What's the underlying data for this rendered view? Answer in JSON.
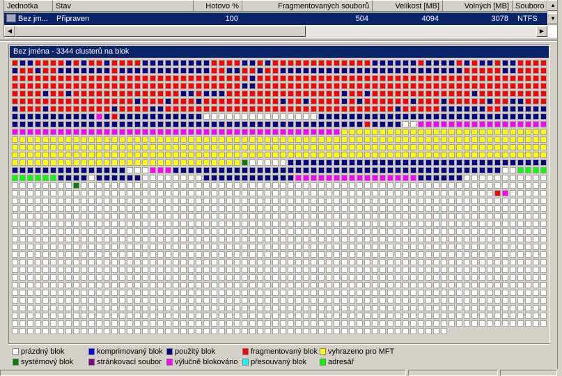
{
  "list": {
    "columns": [
      "Jednotka",
      "Stav",
      "Hotovo %",
      "Fragmentovaných souborů",
      "Velikost [MB]",
      "Volných [MB]",
      "Souboro"
    ],
    "rows": [
      {
        "drive": "Bez jm...",
        "status": "Připraven",
        "done": "100",
        "fragmented": "504",
        "size": "4094",
        "free": "3078",
        "fs": "NTFS"
      }
    ]
  },
  "map": {
    "title": "Bez jména - 3344 clusterů na blok",
    "columns": 70,
    "colors": {
      "W": "#ffffff",
      "B": "#000080",
      "R": "#ff0000",
      "M": "#ff00ff",
      "Y": "#ffff00",
      "G": "#008000",
      "L": "#00ff00",
      "C": "#0000ff",
      "P": "#800080",
      "T": "#00ffff"
    },
    "rows": [
      "R1 B2 R4 B1 R1 B1 R2 B1 R4 B9 R4 B2 R1 B1 R1 R12 B6 R1 B4 R1 B1 R1 B2 R1 B2 R4",
      "B1 R2 B1 R2 B7 R1 B12 R2 B2 R2 B1 R2 B24 R5 B2 R4",
      "R31 B1 R3 R35",
      "R30 B2 R3 R35",
      "R4 B1 R2 B1 R14 B2 R1 B3 R7 R8 B1 R2 B1 R13 B1 R9",
      "R16 B1 R3 B1 R3 B1 R10 B1 R2 B1 R4 B1 R1 B1 R6 B1 R3 B1 R5 B1 R2 B2 R3",
      "B1 R3 B1 R8 B1 R4 B2 R15 R15 B1 R5 B6 R2 B6",
      "B11 M1 B1 R1 B11 W10 W5 B30",
      "B35 B11 R1 B4 W2 M17",
      "M43 Y27",
      "Y70",
      "Y70",
      "Y70",
      "Y30 G1 W5 B34",
      "B15 W3 M3 B43 W2 L4",
      "L6 B4 W1 B6 W8 B12 M16 B6 W11",
      "W8 G1 W61",
      "W63 R1 M1 W5",
      "W70",
      "W70",
      "W70",
      "W70",
      "W70",
      "W70",
      "W70",
      "W70",
      "W70",
      "W70",
      "W70",
      "W70",
      "W70",
      "W70",
      "W70",
      "W70",
      "W70",
      "W57"
    ]
  },
  "legend": [
    {
      "label": "prázdný blok",
      "color": "#ffffff"
    },
    {
      "label": "komprimovaný blok",
      "color": "#0000ff"
    },
    {
      "label": "použitý blok",
      "color": "#000080"
    },
    {
      "label": "fragmentovaný blok",
      "color": "#ff0000"
    },
    {
      "label": "vyhrazeno pro MFT",
      "color": "#ffff00"
    },
    {
      "label": "systémový blok",
      "color": "#008000"
    },
    {
      "label": "stránkovací soubor",
      "color": "#800080"
    },
    {
      "label": "výlučně blokováno",
      "color": "#ff00ff"
    },
    {
      "label": "přesouvaný blok",
      "color": "#00ffff"
    },
    {
      "label": "adresář",
      "color": "#00ff00"
    }
  ]
}
